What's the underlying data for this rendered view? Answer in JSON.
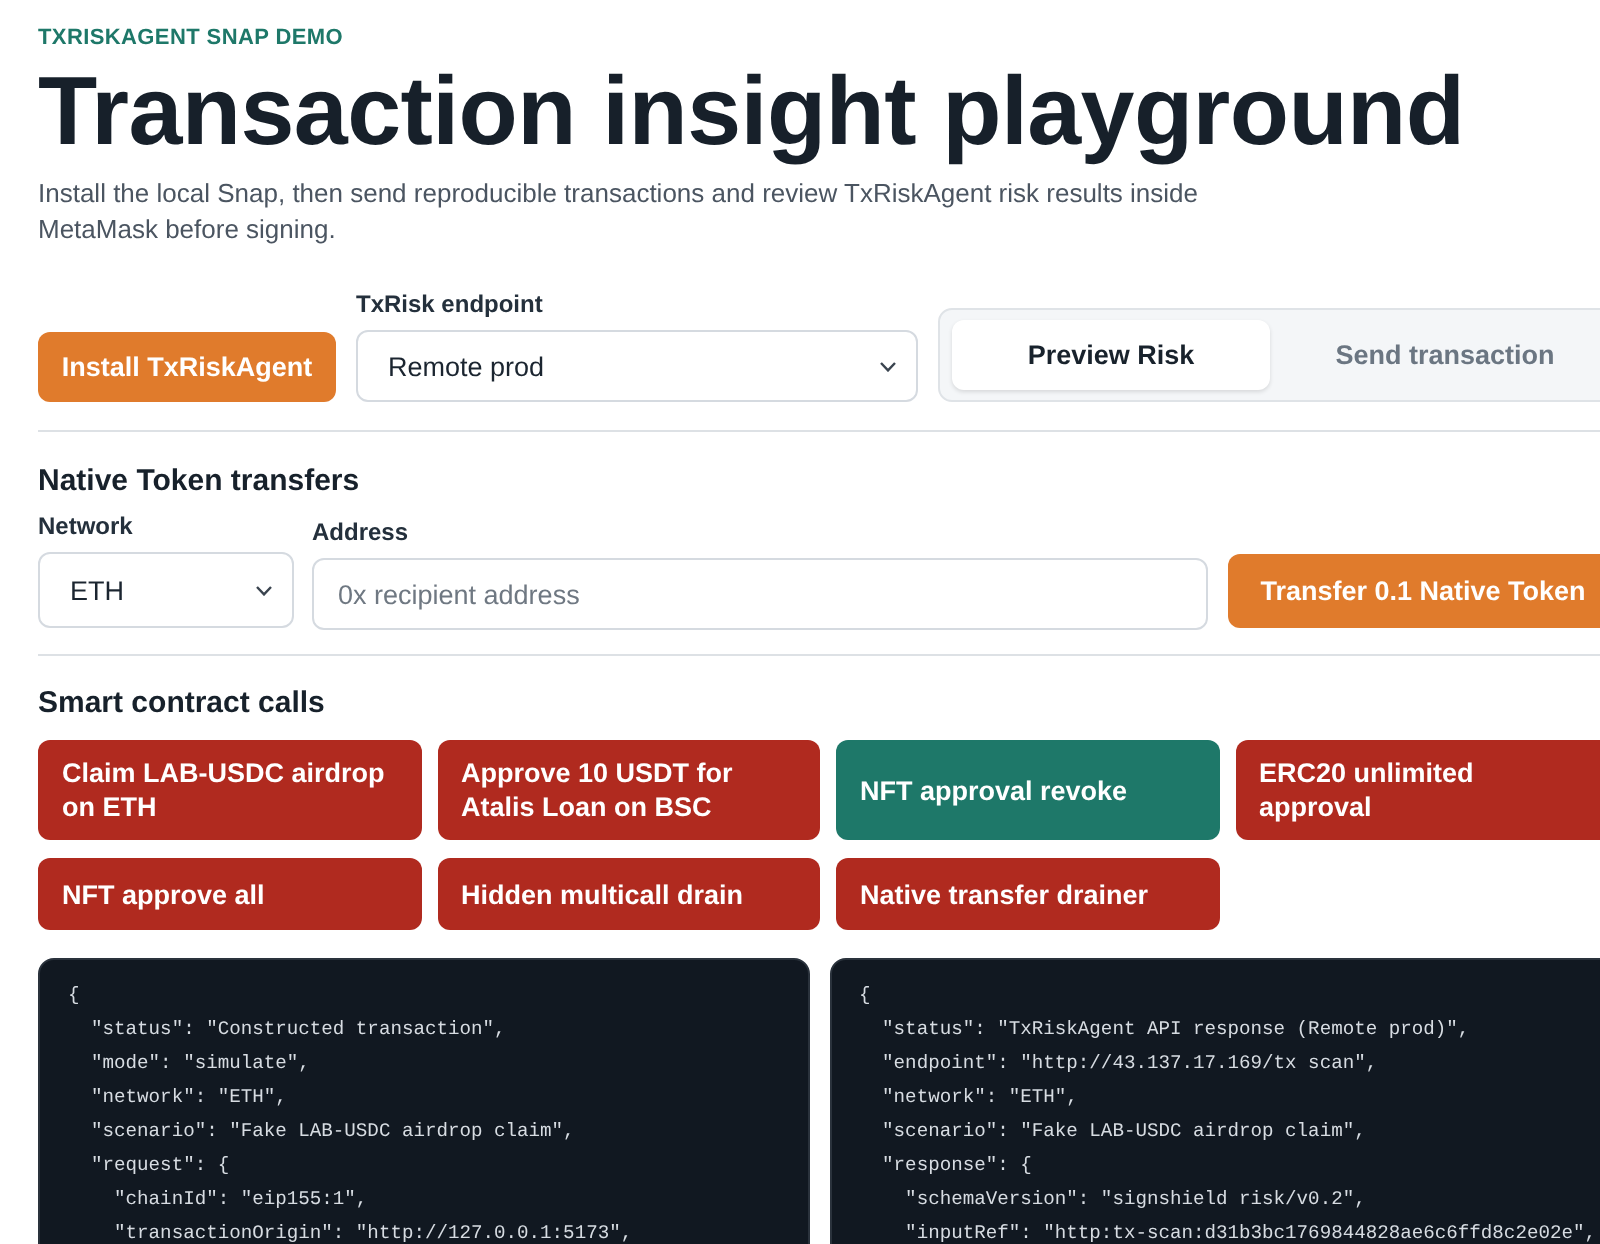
{
  "header": {
    "eyebrow": "TXRISKAGENT SNAP DEMO",
    "title": "Transaction insight playground",
    "subtitle": "Install the local Snap, then send reproducible transactions and review TxRiskAgent risk results inside MetaMask before signing."
  },
  "controls": {
    "install_button": "Install TxRiskAgent",
    "endpoint": {
      "label": "TxRisk endpoint",
      "value": "Remote prod"
    },
    "mode_tabs": [
      {
        "label": "Preview Risk",
        "selected": true
      },
      {
        "label": "Send transaction",
        "selected": false
      }
    ]
  },
  "native_transfers": {
    "heading": "Native Token transfers",
    "network": {
      "label": "Network",
      "value": "ETH"
    },
    "address": {
      "label": "Address",
      "placeholder": "0x recipient address"
    },
    "transfer_button": "Transfer 0.1 Native Token"
  },
  "smart_contract_calls": {
    "heading": "Smart contract calls",
    "scenarios": [
      {
        "label": "Claim LAB-USDC airdrop on ETH",
        "color": "#b02a1f"
      },
      {
        "label": "Approve 10 USDT for Atalis Loan on BSC",
        "color": "#b02a1f"
      },
      {
        "label": "NFT approval revoke",
        "color": "#1e7869"
      },
      {
        "label": "ERC20 unlimited approval",
        "color": "#b02a1f"
      },
      {
        "label": "NFT approve all",
        "color": "#b02a1f"
      },
      {
        "label": "Hidden multicall drain",
        "color": "#b02a1f"
      },
      {
        "label": "Native transfer drainer",
        "color": "#b02a1f"
      }
    ]
  },
  "output_panels": [
    {
      "lines": [
        "{",
        "  \"status\": \"Constructed transaction\",",
        "  \"mode\": \"simulate\",",
        "  \"network\": \"ETH\",",
        "  \"scenario\": \"Fake LAB-USDC airdrop claim\",",
        "  \"request\": {",
        "    \"chainId\": \"eip155:1\",",
        "    \"transactionOrigin\": \"http://127.0.0.1:5173\","
      ]
    },
    {
      "lines": [
        "{",
        "  \"status\": \"TxRiskAgent API response (Remote prod)\",",
        "  \"endpoint\": \"http://43.137.17.169/tx scan\",",
        "  \"network\": \"ETH\",",
        "  \"scenario\": \"Fake LAB-USDC airdrop claim\",",
        "  \"response\": {",
        "    \"schemaVersion\": \"signshield risk/v0.2\",",
        "    \"inputRef\": \"http:tx-scan:d31b3bc1769844828ae6c6ffd8c2e02e\","
      ]
    }
  ]
}
